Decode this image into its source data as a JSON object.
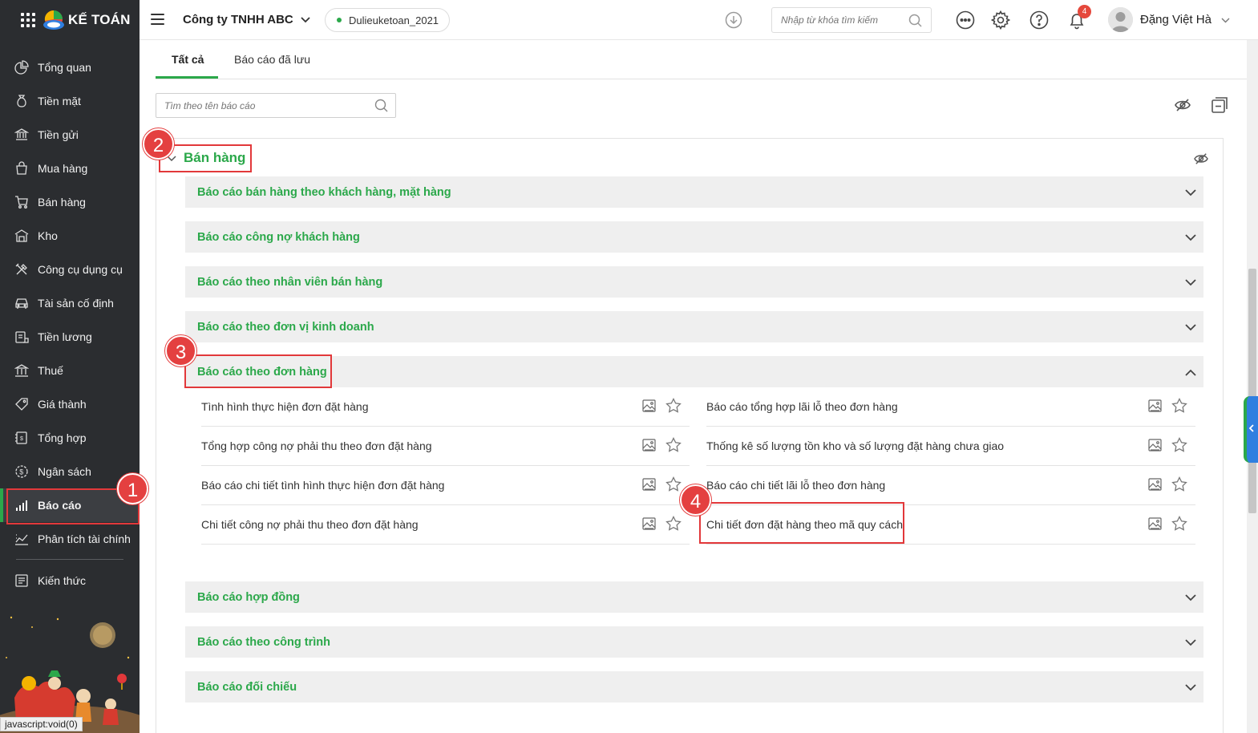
{
  "app": {
    "logo_text": "KẾ TOÁN",
    "company": "Công ty TNHH ABC",
    "database": "Dulieuketoan_2021",
    "search_placeholder": "Nhập từ khóa tìm kiếm",
    "notification_count": "4",
    "user_name": "Đặng Việt Hà"
  },
  "sidebar": {
    "items": [
      {
        "label": "Tổng quan",
        "icon": "pie-chart-icon"
      },
      {
        "label": "Tiền mặt",
        "icon": "money-bag-icon"
      },
      {
        "label": "Tiền gửi",
        "icon": "bank-icon"
      },
      {
        "label": "Mua hàng",
        "icon": "shopping-bag-icon"
      },
      {
        "label": "Bán hàng",
        "icon": "cart-icon"
      },
      {
        "label": "Kho",
        "icon": "warehouse-icon"
      },
      {
        "label": "Công cụ dụng cụ",
        "icon": "tools-icon"
      },
      {
        "label": "Tài sản cố định",
        "icon": "car-icon"
      },
      {
        "label": "Tiền lương",
        "icon": "payroll-icon"
      },
      {
        "label": "Thuế",
        "icon": "tax-building-icon"
      },
      {
        "label": "Giá thành",
        "icon": "price-tag-icon"
      },
      {
        "label": "Tổng hợp",
        "icon": "ledger-icon"
      },
      {
        "label": "Ngân sách",
        "icon": "budget-coin-icon"
      },
      {
        "label": "Báo cáo",
        "icon": "bar-chart-icon",
        "active": true
      },
      {
        "label": "Phân tích tài chính",
        "icon": "trend-chart-icon"
      }
    ],
    "knowledge": {
      "label": "Kiến thức",
      "icon": "book-icon"
    },
    "status_text": "javascript:void(0)"
  },
  "tabs": {
    "all": "Tất cả",
    "saved": "Báo cáo đã lưu"
  },
  "report_search_placeholder": "Tìm theo tên báo cáo",
  "group": {
    "title": "Bán hàng",
    "sections": [
      "Báo cáo bán hàng theo khách hàng, mặt hàng",
      "Báo cáo công nợ khách hàng",
      "Báo cáo theo nhân viên bán hàng",
      "Báo cáo theo đơn vị kinh doanh",
      "Báo cáo theo đơn hàng",
      "Báo cáo hợp đồng",
      "Báo cáo theo công trình",
      "Báo cáo đối chiếu"
    ],
    "expanded_reports_left": [
      "Tình hình thực hiện đơn đặt hàng",
      "Tổng hợp công nợ phải thu theo đơn đặt hàng",
      "Báo cáo chi tiết tình hình thực hiện đơn đặt hàng",
      "Chi tiết công nợ phải thu theo đơn đặt hàng"
    ],
    "expanded_reports_right": [
      "Báo cáo tổng hợp lãi lỗ theo đơn hàng",
      "Thống kê số lượng tồn kho và số lượng đặt hàng chưa giao",
      "Báo cáo chi tiết lãi lỗ theo đơn hàng",
      "Chi tiết đơn đặt hàng theo mã quy cách"
    ]
  },
  "annotations": [
    "1",
    "2",
    "3",
    "4"
  ],
  "colors": {
    "accent_green": "#2ba84a",
    "sidebar_bg": "#2b2d30",
    "annotation_red": "#e2383a",
    "badge_red": "#e5483c"
  }
}
